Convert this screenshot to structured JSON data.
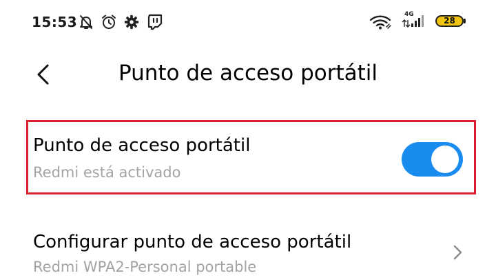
{
  "status_bar": {
    "time": "15:53",
    "icons": [
      "bell-off-icon",
      "alarm-clock-icon",
      "gear-icon",
      "twitch-icon",
      "wifi-icon",
      "signal-icon"
    ],
    "network_type": "4G",
    "battery": "28",
    "battery_color": "#f1c40f"
  },
  "header": {
    "back_icon": "chevron-left-icon",
    "title": "Punto de acceso portátil"
  },
  "hotspot": {
    "title": "Punto de acceso portátil",
    "subtitle": "Redmi está activado",
    "enabled": true,
    "toggle_color": "#1a8cf0",
    "highlight_color": "#d9202e"
  },
  "configure": {
    "title": "Configurar punto de acceso portátil",
    "subtitle": "Redmi WPA2-Personal portable",
    "chevron_icon": "chevron-right-icon"
  }
}
